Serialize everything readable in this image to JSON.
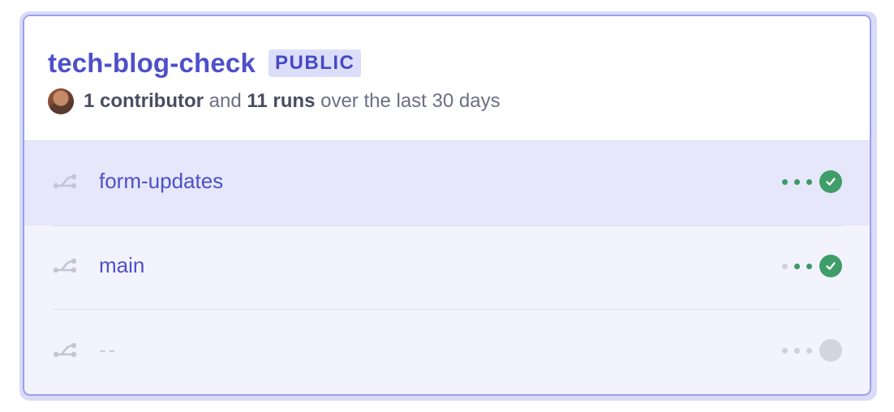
{
  "repo": {
    "name": "tech-blog-check",
    "visibility": "PUBLIC"
  },
  "stats": {
    "contributors": "1 contributor",
    "and": " and ",
    "runs": "11 runs",
    "period": " over the last 30 days"
  },
  "branches": [
    {
      "name": "form-updates",
      "dots": [
        "green",
        "green",
        "green"
      ],
      "status": "success"
    },
    {
      "name": "main",
      "dots": [
        "grey",
        "green",
        "green"
      ],
      "status": "success"
    },
    {
      "name": "--",
      "dots": [
        "grey",
        "grey",
        "grey"
      ],
      "status": "none"
    }
  ],
  "colors": {
    "accent": "#4d50c9",
    "success": "#3f9d69",
    "active_row": "#e6e7fa"
  },
  "icons": {
    "branch": "git-branch-icon",
    "check": "check-circle-icon",
    "pending": "empty-circle-icon"
  }
}
